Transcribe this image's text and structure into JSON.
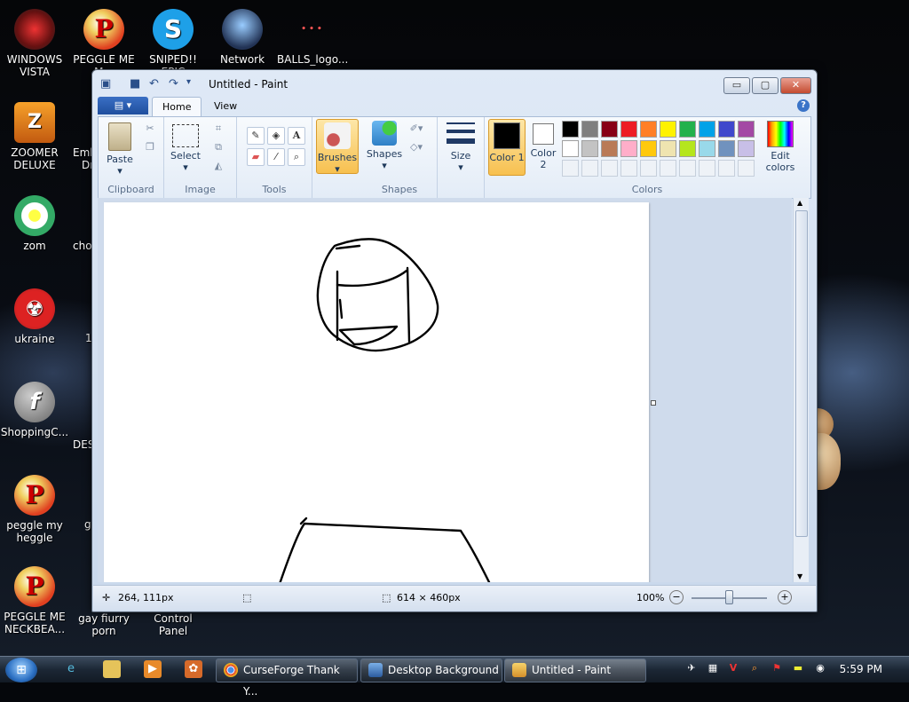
{
  "desktop": {
    "icons": [
      {
        "label": "WINDOWS VISTA"
      },
      {
        "label": "PEGGLE ME M..."
      },
      {
        "label": "SNIPED!! EPIC"
      },
      {
        "label": "Network"
      },
      {
        "label": "BALLS_logo..."
      },
      {
        "label": "ZOOMER DELUXE"
      },
      {
        "label": "zom"
      },
      {
        "label": "ukraine"
      },
      {
        "label": "ShoppingC..."
      },
      {
        "label": "peggle my heggle"
      },
      {
        "label": "PEGGLE ME NECKBEA..."
      },
      {
        "label": "gay fiurry porn"
      },
      {
        "label": "Control Panel"
      }
    ],
    "partial_labels": [
      "Emb",
      "Dr",
      "cho",
      "1",
      "DES",
      "g"
    ]
  },
  "window": {
    "title": "Untitled - Paint",
    "controls": {
      "minimize": "▭",
      "maximize": "▢",
      "close": "✕"
    }
  },
  "ribbon": {
    "tabs": [
      "Home",
      "View"
    ],
    "groups": {
      "clipboard": {
        "label": "Clipboard",
        "paste": "Paste"
      },
      "image": {
        "label": "Image",
        "select": "Select"
      },
      "tools": {
        "label": "Tools"
      },
      "brushes": {
        "label": "Brushes"
      },
      "shapes": {
        "label": "Shapes",
        "button": "Shapes"
      },
      "size": {
        "label": "Size"
      },
      "colors": {
        "label": "Colors",
        "color1": "Color 1",
        "color2": "Color 2",
        "edit": "Edit colors",
        "row1": [
          "#000000",
          "#7f7f7f",
          "#880015",
          "#ed1c24",
          "#ff7f27",
          "#fff200",
          "#22b14c",
          "#00a2e8",
          "#3f48cc",
          "#a349a4"
        ],
        "row2": [
          "#ffffff",
          "#c3c3c3",
          "#b97a57",
          "#ffaec9",
          "#ffc90e",
          "#efe4b0",
          "#b5e61d",
          "#99d9ea",
          "#7092be",
          "#c8bfe7"
        ]
      }
    }
  },
  "status": {
    "cursor": "264, 111px",
    "size": "614 × 460px",
    "zoom": "100%"
  },
  "taskbar": {
    "buttons": [
      "CurseForge Thank Y...",
      "Desktop Background",
      "Untitled - Paint"
    ],
    "clock": "5:59 PM"
  }
}
